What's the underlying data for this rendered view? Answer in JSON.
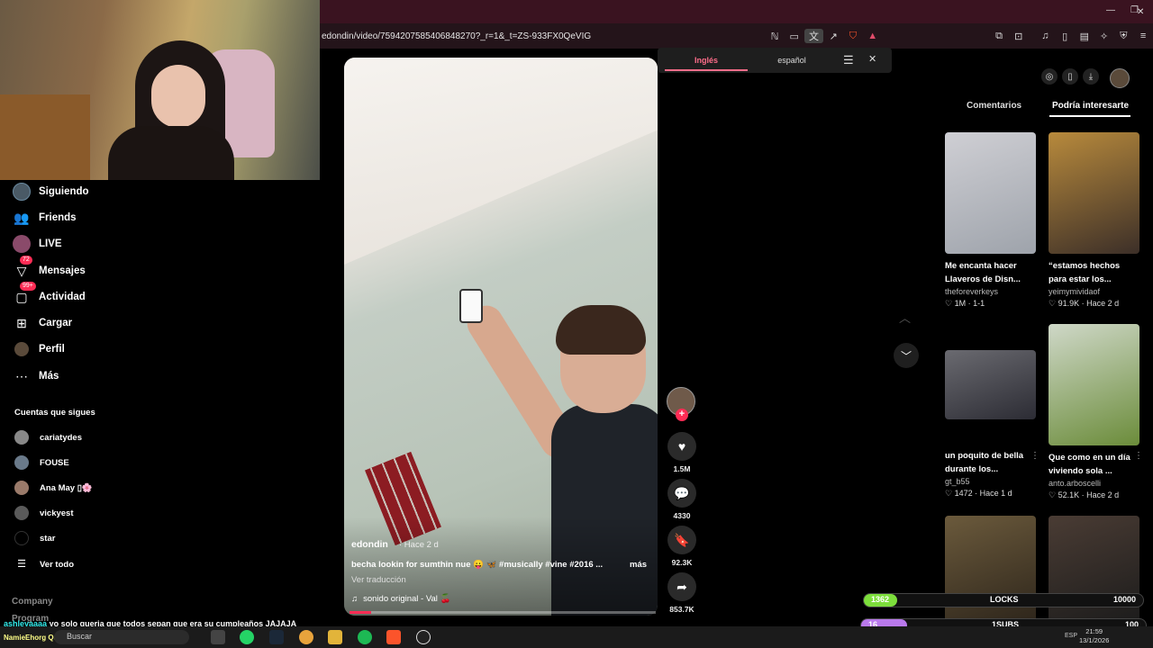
{
  "browser": {
    "url": "edondin/video/7594207585406848270?_r=1&_t=ZS-933FX0QeVIG",
    "window_controls": {
      "minimize": "—",
      "restore": "❐",
      "close": "✕"
    }
  },
  "sidebar": {
    "nav": [
      {
        "label": "Siguiendo",
        "icon": "following-avatar-icon"
      },
      {
        "label": "Friends",
        "icon": "friends-icon"
      },
      {
        "label": "LIVE",
        "icon": "live-icon"
      },
      {
        "label": "Mensajes",
        "icon": "messages-icon",
        "badge": "72"
      },
      {
        "label": "Actividad",
        "icon": "activity-icon",
        "badge": "99+"
      },
      {
        "label": "Cargar",
        "icon": "upload-icon"
      },
      {
        "label": "Perfil",
        "icon": "profile-icon"
      },
      {
        "label": "Más",
        "icon": "more-icon"
      }
    ],
    "following_title": "Cuentas que sigues",
    "following": [
      {
        "name": "cariatydes"
      },
      {
        "name": "FOUSE"
      },
      {
        "name": "Ana May ▯🌸"
      },
      {
        "name": "vickyest"
      },
      {
        "name": "star"
      }
    ],
    "see_all": "Ver todo",
    "company": "Company",
    "program": "Program"
  },
  "video": {
    "author": "edondin",
    "age": "· Hace 2 d",
    "caption": "becha lookin for sumthin nue 😛 🦋 #musically #vine #2016 ...",
    "more": "más",
    "translate": "Ver traducción",
    "sound_icon": "♫",
    "sound": "sonido original - Val 🍒",
    "progress": 0.07
  },
  "actions": {
    "likes": "1.5M",
    "comments": "4330",
    "saves": "92.3K",
    "shares": "853.7K"
  },
  "translate_popup": {
    "source": "Inglés",
    "target": "español"
  },
  "right_panel": {
    "tabs": {
      "comments": "Comentarios",
      "suggested": "Podría interesarte"
    },
    "cards": [
      {
        "title": "Me encanta hacer Llaveros de Disn...",
        "author": "theforeverkeys",
        "likes": "1M",
        "age": "1-1",
        "palette": [
          "#cfcfd4",
          "#9ea3ab"
        ]
      },
      {
        "title": "“estamos hechos para estar los...",
        "author": "yeimymividaof",
        "likes": "91.9K",
        "age": "Hace 2 d",
        "palette": [
          "#b88a3c",
          "#3c2f28"
        ]
      },
      {
        "title": "un poquito de bella durante los...",
        "author": "gt_b55",
        "likes": "1472",
        "age": "Hace 1 d",
        "palette": [
          "#6a6a70",
          "#2c2c34"
        ]
      },
      {
        "title": "Que como en un día viviendo sola ...",
        "author": "anto.arboscelli",
        "likes": "52.1K",
        "age": "Hace 2 d",
        "palette": [
          "#cfd8c8",
          "#6b8c3a"
        ]
      },
      {
        "title": "",
        "author": "",
        "likes": "",
        "age": "",
        "palette": [
          "#6b5a3c",
          "#2c241a"
        ]
      },
      {
        "title": "",
        "author": "",
        "likes": "",
        "age": "",
        "palette": [
          "#4a3c34",
          "#1b1b1b"
        ]
      }
    ]
  },
  "stream_overlay": {
    "bar1_left": "1362",
    "bar1_mid": "LOCKS",
    "bar1_right": "10000",
    "bar1_fill": 0.04,
    "bar1_color": "#7dde3c",
    "bar2_left": "16",
    "bar2_mid": "1SUBS",
    "bar2_right": "100",
    "bar2_fill": 0.16,
    "bar2_color": "#b979ec",
    "chat_user": "ashleyaaaa",
    "chat_text": "yo solo queria que todos sepan que era su cumpleaños JAJAJA",
    "chat_bottom": "NamieEhorg  Quiero saludar al stream y te amo uwu"
  },
  "taskbar": {
    "search": "Buscar",
    "time": "21:59",
    "date": "13/1/2026",
    "lang": "ESP"
  },
  "colors": {
    "accent": "#fe2c55",
    "titlebar": "#3a1320"
  }
}
